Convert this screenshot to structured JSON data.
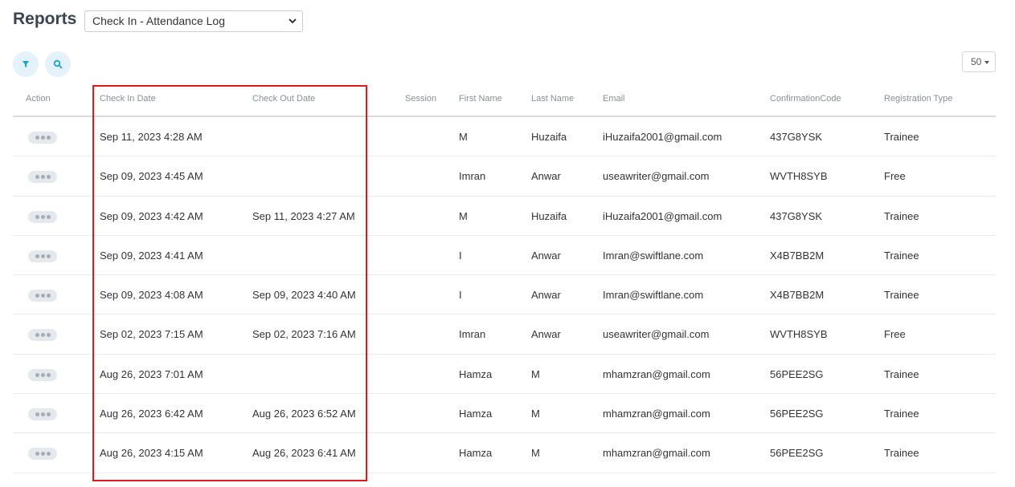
{
  "header": {
    "title": "Reports",
    "report_select_value": "Check In - Attendance Log"
  },
  "toolbar": {
    "filter_icon": "filter-icon",
    "search_icon": "search-icon",
    "page_size": "50"
  },
  "table": {
    "columns": {
      "action": "Action",
      "check_in": "Check In Date",
      "check_out": "Check Out Date",
      "session": "Session",
      "first_name": "First Name",
      "last_name": "Last Name",
      "email": "Email",
      "confirmation": "ConfirmationCode",
      "registration": "Registration Type"
    },
    "rows": [
      {
        "check_in": "Sep 11, 2023 4:28 AM",
        "check_out": "",
        "session": "",
        "first_name": "M",
        "last_name": "Huzaifa",
        "email": "iHuzaifa2001@gmail.com",
        "confirmation": "437G8YSK",
        "registration": "Trainee"
      },
      {
        "check_in": "Sep 09, 2023 4:45 AM",
        "check_out": "",
        "session": "",
        "first_name": "Imran",
        "last_name": "Anwar",
        "email": "useawriter@gmail.com",
        "confirmation": "WVTH8SYB",
        "registration": "Free"
      },
      {
        "check_in": "Sep 09, 2023 4:42 AM",
        "check_out": "Sep 11, 2023 4:27 AM",
        "session": "",
        "first_name": "M",
        "last_name": "Huzaifa",
        "email": "iHuzaifa2001@gmail.com",
        "confirmation": "437G8YSK",
        "registration": "Trainee"
      },
      {
        "check_in": "Sep 09, 2023 4:41 AM",
        "check_out": "",
        "session": "",
        "first_name": "I",
        "last_name": "Anwar",
        "email": "Imran@swiftlane.com",
        "confirmation": "X4B7BB2M",
        "registration": "Trainee"
      },
      {
        "check_in": "Sep 09, 2023 4:08 AM",
        "check_out": "Sep 09, 2023 4:40 AM",
        "session": "",
        "first_name": "I",
        "last_name": "Anwar",
        "email": "Imran@swiftlane.com",
        "confirmation": "X4B7BB2M",
        "registration": "Trainee"
      },
      {
        "check_in": "Sep 02, 2023 7:15 AM",
        "check_out": "Sep 02, 2023 7:16 AM",
        "session": "",
        "first_name": "Imran",
        "last_name": "Anwar",
        "email": "useawriter@gmail.com",
        "confirmation": "WVTH8SYB",
        "registration": "Free"
      },
      {
        "check_in": "Aug 26, 2023 7:01 AM",
        "check_out": "",
        "session": "",
        "first_name": "Hamza",
        "last_name": "M",
        "email": "mhamzran@gmail.com",
        "confirmation": "56PEE2SG",
        "registration": "Trainee"
      },
      {
        "check_in": "Aug 26, 2023 6:42 AM",
        "check_out": "Aug 26, 2023 6:52 AM",
        "session": "",
        "first_name": "Hamza",
        "last_name": "M",
        "email": "mhamzran@gmail.com",
        "confirmation": "56PEE2SG",
        "registration": "Trainee"
      },
      {
        "check_in": "Aug 26, 2023 4:15 AM",
        "check_out": "Aug 26, 2023 6:41 AM",
        "session": "",
        "first_name": "Hamza",
        "last_name": "M",
        "email": "mhamzran@gmail.com",
        "confirmation": "56PEE2SG",
        "registration": "Trainee"
      }
    ]
  },
  "colors": {
    "accent": "#1aa0d8",
    "button_bg": "#e4f2fb",
    "highlight": "#e01a1a"
  }
}
